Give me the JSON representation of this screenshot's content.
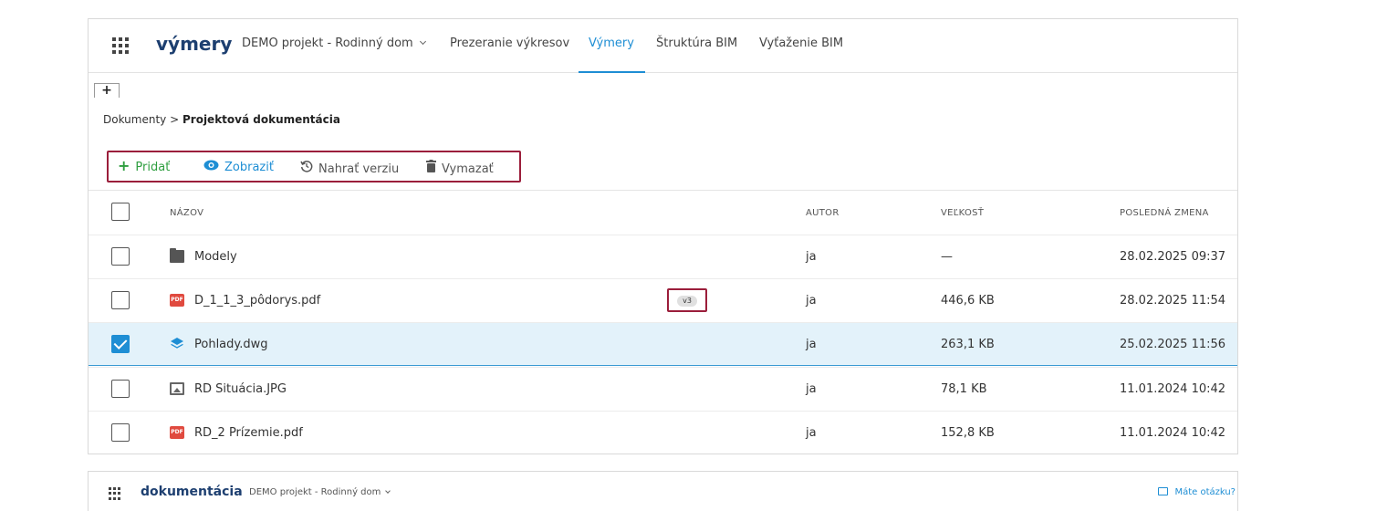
{
  "app": {
    "logo": "výmery",
    "project_selector": "DEMO projekt - Rodinný dom",
    "nav": [
      "Prezeranie výkresov",
      "Výmery",
      "Štruktúra BIM",
      "Vyťaženie BIM"
    ],
    "active_tab": "Výmery",
    "accent_color": "#1e8ed4",
    "highlight_color": "#9b1e3b"
  },
  "tabs": {
    "add_label": "+"
  },
  "breadcrumb": {
    "root": "Dokumenty",
    "separator": ">",
    "current": "Projektová dokumentácia"
  },
  "toolbar": {
    "add": {
      "icon": "plus-icon",
      "label": "Pridať",
      "color": "#2e9e3f"
    },
    "view": {
      "icon": "eye-icon",
      "label": "Zobraziť",
      "color": "#1e8ed4"
    },
    "upload_version": {
      "icon": "history-icon",
      "label": "Nahrať verziu",
      "color": "#555555"
    },
    "delete": {
      "icon": "trash-icon",
      "label": "Vymazať",
      "color": "#555555"
    }
  },
  "table": {
    "columns": {
      "name": "NÁZOV",
      "author": "AUTOR",
      "size": "VEĽKOSŤ",
      "modified": "POSLEDNÁ ZMENA"
    },
    "rows": [
      {
        "icon": "folder-icon",
        "name": "Modely",
        "version": "",
        "author": "ja",
        "size": "—",
        "modified": "28.02.2025 09:37",
        "checked": false
      },
      {
        "icon": "pdf-icon",
        "name": "D_1_1_3_pôdorys.pdf",
        "version": "v3",
        "author": "ja",
        "size": "446,6 KB",
        "modified": "28.02.2025 11:54",
        "checked": false
      },
      {
        "icon": "layers-icon",
        "name": "Pohlady.dwg",
        "version": "",
        "author": "ja",
        "size": "263,1 KB",
        "modified": "25.02.2025 11:56",
        "checked": true
      },
      {
        "icon": "image-icon",
        "name": "RD Situácia.JPG",
        "version": "",
        "author": "ja",
        "size": "78,1 KB",
        "modified": "11.01.2024 10:42",
        "checked": false
      },
      {
        "icon": "pdf-icon",
        "name": "RD_2 Prízemie.pdf",
        "version": "",
        "author": "ja",
        "size": "152,8 KB",
        "modified": "11.01.2024 10:42",
        "checked": false
      }
    ]
  },
  "second_app": {
    "logo": "dokumentácia",
    "project_selector": "DEMO projekt - Rodinný dom",
    "help": "Máte otázku?"
  }
}
